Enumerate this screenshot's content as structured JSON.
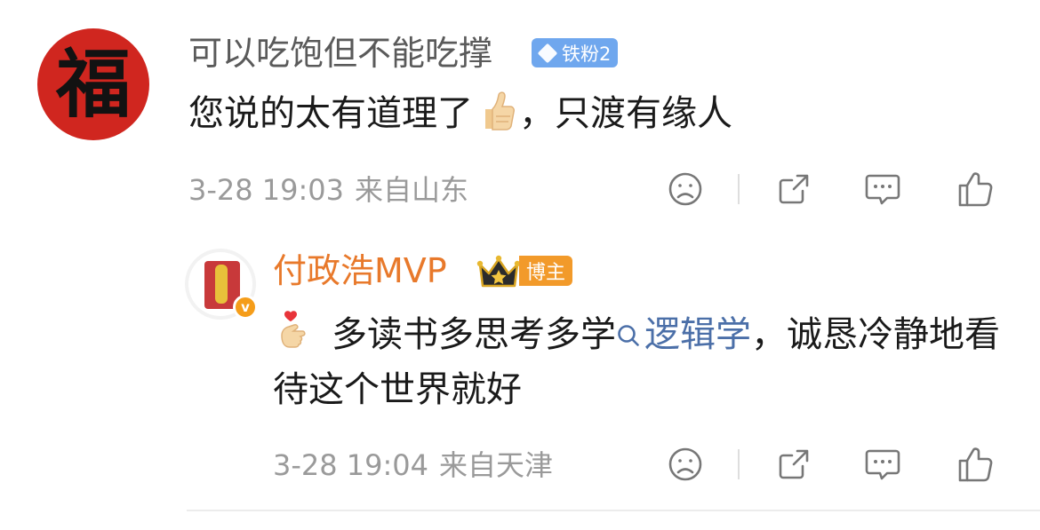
{
  "comment": {
    "avatar_glyph": "福",
    "username": "可以吃饱但不能吃撑",
    "fan_badge": "铁粉2",
    "text_before": "您说的太有道理了",
    "text_after": "，只渡有缘人",
    "emoji": "thumbs-up",
    "date": "3-28 19:03",
    "location": "来自山东"
  },
  "reply": {
    "username": "付政浩MVP",
    "verified_mark": "v",
    "host_badge": "博主",
    "emoji": "finger-heart",
    "text_lead": "多读书多思考多学",
    "topic": "逻辑学",
    "text_tail": "，诚恳冷静地看待这个世界就好",
    "date": "3-28 19:04",
    "location": "来自天津"
  },
  "actions": [
    "sad-face-icon",
    "share-icon",
    "comment-icon",
    "like-icon"
  ],
  "colors": {
    "username_gray": "#5a5a5a",
    "blogger_orange": "#e8792b",
    "fan_badge_blue": "#6fa7ee",
    "host_badge_orange": "#f29a2a",
    "topic_link": "#4b6fa8",
    "meta_gray": "#9a9a9a",
    "avatar_red": "#d0261f"
  }
}
